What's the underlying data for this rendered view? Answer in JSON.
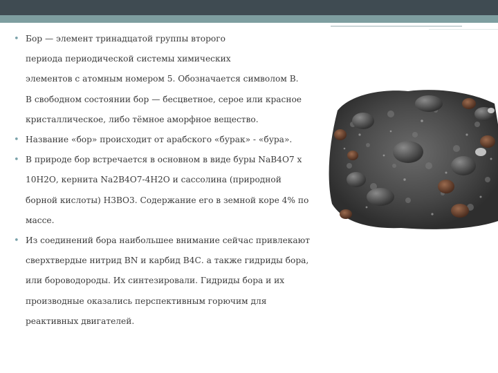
{
  "bullets": [
    {
      "lines": [
        "Бор — элемент тринадцатой группы второго",
        "периода периодической системы химических",
        "элементов с атомным номером 5. Обозначается символом В.",
        "В свободном состоянии бор — бесцветное, серое или красное",
        "кристаллическое, либо тёмное аморфное вещество."
      ]
    },
    {
      "lines": [
        "Название «бор» происходит от арабского «бурак» - «бура»."
      ]
    },
    {
      "lines": [
        "В природе бор встречается в основном в виде буры NaB4O7 х",
        "10Н2О, кернита Na2B4O7-4H2O и сассолина (природной",
        "борной кислоты) Н3ВО3. Содержание его в земной коре 4% по",
        "массе."
      ]
    },
    {
      "lines": [
        "Из соединений бора наибольшее внимание сейчас привлекают",
        "сверхтвердые нитрид BN и карбид В4С. а также гидриды бора,",
        "или бороводороды. Их синтезировали. Гидриды бора и их",
        "производные оказались перспективным горючим для",
        "реактивных двигателей."
      ]
    }
  ],
  "bullet_glyph": "•",
  "colors": {
    "header_band": "#3f4b52",
    "header_strip": "#7e9ea0",
    "bullet": "#7aa2aa",
    "text": "#3a3a3a"
  }
}
